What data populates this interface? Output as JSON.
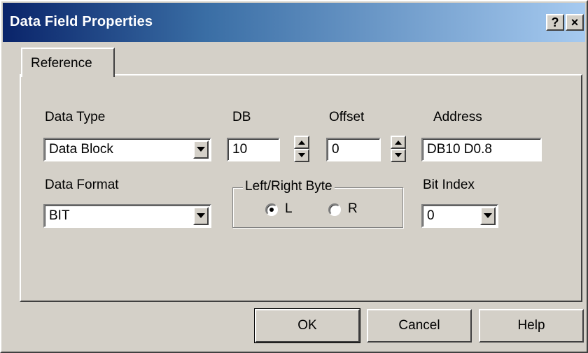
{
  "window": {
    "title": "Data Field Properties"
  },
  "titlebar_buttons": {
    "help": "?",
    "close": "×"
  },
  "tabs": [
    {
      "label": "Reference"
    }
  ],
  "fields": {
    "data_type": {
      "label": "Data Type",
      "value": "Data Block"
    },
    "db": {
      "label": "DB",
      "value": "10"
    },
    "offset": {
      "label": "Offset",
      "value": "0"
    },
    "address": {
      "label": "Address",
      "value": "DB10 D0.8"
    },
    "data_format": {
      "label": "Data Format",
      "value": "BIT"
    },
    "byte_group": {
      "label": "Left/Right Byte",
      "options": [
        "L",
        "R"
      ],
      "selected": "L"
    },
    "bit_index": {
      "label": "Bit Index",
      "value": "0"
    }
  },
  "buttons": {
    "ok": "OK",
    "cancel": "Cancel",
    "help": "Help"
  },
  "icons": [
    "question-icon",
    "close-icon",
    "chevron-down-icon",
    "spin-up-icon",
    "spin-down-icon"
  ],
  "colors": {
    "titlebar_start": "#0a246a",
    "titlebar_end": "#a6caf0",
    "face": "#d4d0c8"
  }
}
